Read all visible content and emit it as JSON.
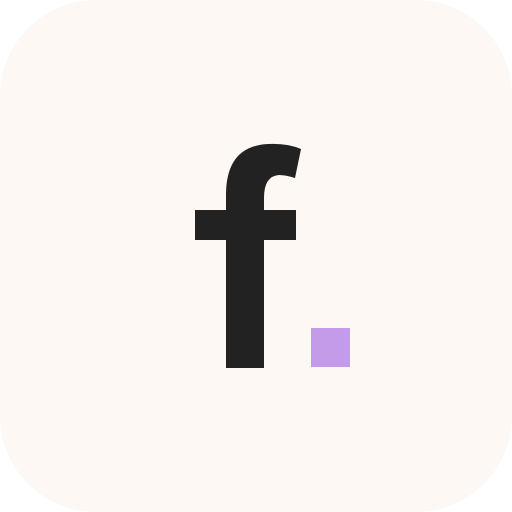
{
  "app_icon": {
    "logo_text": "f.",
    "icon_name": "f-dot-logo-icon",
    "colors": {
      "background": "#fdf8f3",
      "letter": "#222222",
      "dot": "#c39be8"
    }
  }
}
